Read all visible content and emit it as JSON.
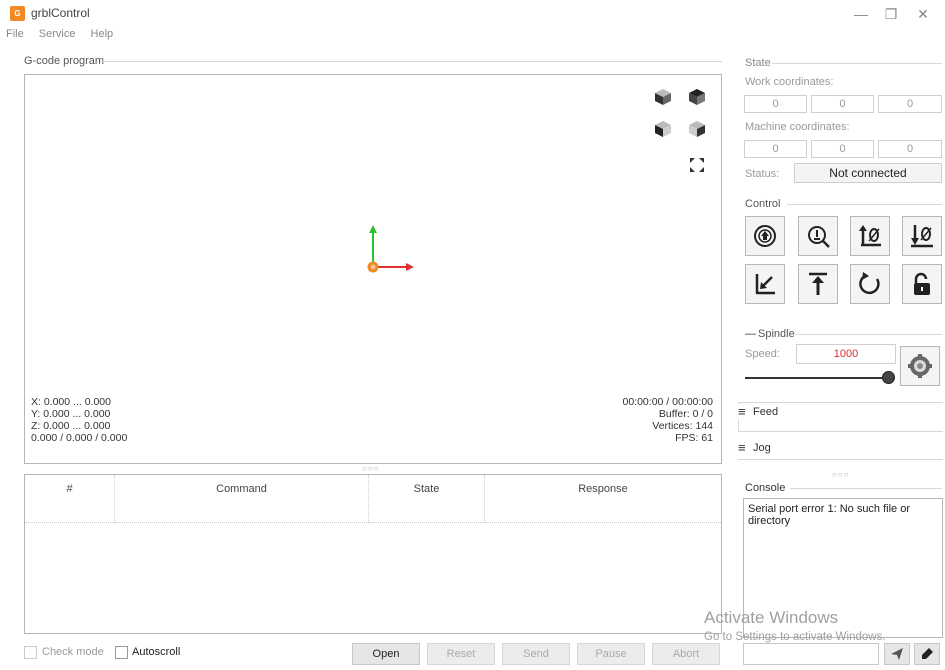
{
  "window": {
    "title": "grblControl",
    "logo_text": "G",
    "minimize": "—",
    "maximize": "❐",
    "close": "✕"
  },
  "menu": [
    "File",
    "Service",
    "Help"
  ],
  "gcode": {
    "group_title": "G-code program",
    "coords": [
      "X: 0.000 ... 0.000",
      "Y: 0.000 ... 0.000",
      "Z: 0.000 ... 0.000",
      "0.000 / 0.000 / 0.000"
    ],
    "time": "00:00:00 / 00:00:00",
    "buffer": "Buffer: 0 / 0",
    "vertices": "Vertices: 144",
    "fps": "FPS: 61",
    "view_icons": [
      "isometric-view-icon",
      "top-view-icon",
      "front-view-icon",
      "left-view-icon",
      "fit-view-icon"
    ]
  },
  "splitter_handle": "○○○",
  "table": {
    "columns": [
      "#",
      "Command",
      "State",
      "Response"
    ]
  },
  "bottom": {
    "check_mode": "Check mode",
    "autoscroll": "Autoscroll",
    "buttons": {
      "open": "Open",
      "reset": "Reset",
      "send": "Send",
      "pause": "Pause",
      "abort": "Abort"
    }
  },
  "state": {
    "group_title": "State",
    "work_label": "Work coordinates:",
    "work": [
      "0",
      "0",
      "0"
    ],
    "machine_label": "Machine coordinates:",
    "machine": [
      "0",
      "0",
      "0"
    ],
    "status_label": "Status:",
    "status_value": "Not connected"
  },
  "control": {
    "group_title": "Control",
    "buttons": [
      "home-icon",
      "zero-probe-icon",
      "zero-xy-icon",
      "zero-z-icon",
      "restore-origin-icon",
      "safe-position-icon",
      "reset-icon",
      "unlock-icon"
    ]
  },
  "spindle": {
    "title": "Spindle",
    "speed_label": "Speed:",
    "speed_value": "1000",
    "collapse": "—",
    "slider_fraction": 1.0
  },
  "feed": {
    "title": "Feed",
    "icon": "≡"
  },
  "jog": {
    "title": "Jog",
    "icon": "≡"
  },
  "console": {
    "group_title": "Console",
    "text": "Serial port error 1: No such file or directory",
    "send_icon": "send-icon",
    "clear_icon": "clear-icon"
  },
  "watermark": {
    "line1": "Activate Windows",
    "line2": "Go to Settings to activate Windows."
  },
  "colors": {
    "axis_x": "#e03030",
    "axis_y": "#2fc02f",
    "origin": "#f08a24",
    "speed": "#d23030"
  }
}
